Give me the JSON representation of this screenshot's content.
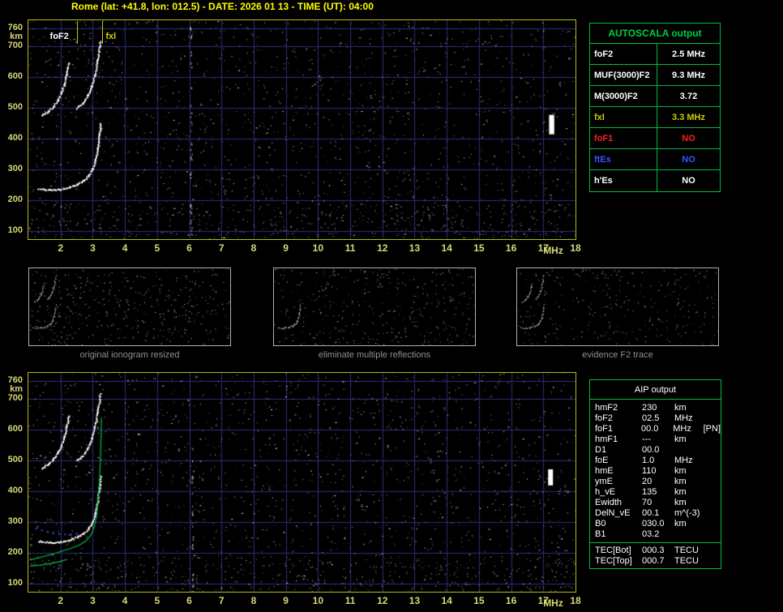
{
  "title": "Rome (lat: +41.8, lon: 012.5) - DATE: 2026 01 13 - TIME (UT): 04:00",
  "colors": {
    "title": "#ffff00",
    "axis_label": "#d8d878",
    "grid": "#2d2d7d",
    "plot_border": "#b8b818",
    "table_border": "#00bb44",
    "trace": "#ffffff",
    "green_overlay": "#00bb44",
    "blue_overlay": "#3355ff",
    "caption": "#909090"
  },
  "ionogram_axes": {
    "x_unit": "MHz",
    "y_unit": "km",
    "x_ticks": [
      2,
      3,
      4,
      5,
      6,
      7,
      8,
      9,
      10,
      11,
      12,
      13,
      14,
      15,
      16,
      17,
      18
    ],
    "y_ticks": [
      100,
      200,
      300,
      400,
      500,
      600,
      700,
      760
    ],
    "x_range": [
      1.0,
      18.0
    ],
    "y_range": [
      75,
      785
    ]
  },
  "traces": [
    {
      "name": "F-trace-first-order",
      "points": [
        [
          1.3,
          240
        ],
        [
          1.7,
          236
        ],
        [
          2.0,
          239
        ],
        [
          2.25,
          245
        ],
        [
          2.5,
          254
        ],
        [
          2.7,
          266
        ],
        [
          2.85,
          282
        ],
        [
          2.97,
          303
        ],
        [
          3.07,
          332
        ],
        [
          3.14,
          370
        ],
        [
          3.19,
          415
        ],
        [
          3.23,
          450
        ]
      ]
    },
    {
      "name": "second-order-O",
      "points": [
        [
          1.4,
          478
        ],
        [
          1.6,
          490
        ],
        [
          1.75,
          506
        ],
        [
          1.9,
          527
        ],
        [
          2.0,
          550
        ],
        [
          2.1,
          578
        ],
        [
          2.18,
          613
        ],
        [
          2.24,
          648
        ]
      ]
    },
    {
      "name": "second-order-X",
      "points": [
        [
          2.5,
          502
        ],
        [
          2.68,
          518
        ],
        [
          2.83,
          542
        ],
        [
          2.95,
          572
        ],
        [
          3.05,
          610
        ],
        [
          3.14,
          658
        ],
        [
          3.22,
          718
        ]
      ]
    }
  ],
  "top_ionogram": {
    "noise_seed": 7,
    "noise_count": 1600,
    "trace_ids": [
      0,
      1,
      2
    ],
    "band_noise": {
      "count": 320,
      "km_max": 190
    },
    "streaks": [
      {
        "x": 6.05,
        "km1": 75,
        "km2": 785,
        "count": 42
      }
    ],
    "blobs": [
      {
        "x1": 17.18,
        "x2": 17.34,
        "y1": 415,
        "y2": 478
      }
    ],
    "annotations": [
      {
        "label": "foF2",
        "freq_mhz": 2.5,
        "color": "#ffffff"
      },
      {
        "label": "fxl",
        "freq_mhz": 3.3,
        "color": "#cccc00"
      }
    ]
  },
  "bottom_ionogram": {
    "noise_seed": 13,
    "noise_count": 1600,
    "trace_ids": [
      0,
      1,
      2
    ],
    "band_noise": {
      "count": 300,
      "km_max": 190
    },
    "streaks": [
      {
        "x": 6.1,
        "km1": 75,
        "km2": 540,
        "count": 36
      }
    ],
    "blobs": [
      {
        "x1": 17.15,
        "x2": 17.3,
        "y1": 420,
        "y2": 472
      }
    ],
    "overlays": [
      {
        "name": "model-F2-trace",
        "color": "#00bb44",
        "style": "line",
        "points": [
          [
            1.05,
            178
          ],
          [
            1.5,
            190
          ],
          [
            1.9,
            202
          ],
          [
            2.3,
            215
          ],
          [
            2.6,
            227
          ],
          [
            2.8,
            241
          ],
          [
            2.95,
            260
          ],
          [
            3.05,
            286
          ],
          [
            3.12,
            322
          ],
          [
            3.18,
            382
          ],
          [
            3.22,
            455
          ],
          [
            3.25,
            545
          ],
          [
            3.27,
            640
          ]
        ]
      },
      {
        "name": "model-E-profile",
        "color": "#00bb44",
        "style": "line",
        "points": [
          [
            1.05,
            158
          ],
          [
            1.35,
            161
          ],
          [
            1.65,
            166
          ],
          [
            1.95,
            172
          ],
          [
            2.2,
            180
          ]
        ]
      },
      {
        "name": "hmF2-markers",
        "color": "#3355ff",
        "style": "dots",
        "points": [
          [
            1.25,
            280
          ],
          [
            1.42,
            274
          ],
          [
            1.6,
            269
          ],
          [
            1.78,
            265
          ],
          [
            1.96,
            262
          ],
          [
            2.14,
            261
          ],
          [
            2.32,
            261
          ],
          [
            2.5,
            263
          ]
        ]
      }
    ]
  },
  "autoscala_table": {
    "header": "AUTOSCALA output",
    "rows": [
      {
        "param": "foF2",
        "value": "2.5 MHz",
        "color": "#ffffff"
      },
      {
        "param": "MUF(3000)F2",
        "value": "9.3 MHz",
        "color": "#ffffff"
      },
      {
        "param": "M(3000)F2",
        "value": "3.72",
        "color": "#ffffff"
      },
      {
        "param": "fxl",
        "value": "3.3 MHz",
        "color": "#cccc00"
      },
      {
        "param": "foF1",
        "value": "NO",
        "color": "#ff2020"
      },
      {
        "param": "ftEs",
        "value": "NO",
        "color": "#3355ff"
      },
      {
        "param": "h'Es",
        "value": "NO",
        "color": "#ffffff"
      }
    ]
  },
  "thumbnails": [
    {
      "caption": "original ionogram resized",
      "noise_seed": 21,
      "noise_count": 430,
      "trace_ids": [
        0,
        1,
        2
      ]
    },
    {
      "caption": "eliminate multiple reflections",
      "noise_seed": 33,
      "noise_count": 390,
      "trace_ids": [
        0
      ]
    },
    {
      "caption": "evidence F2 trace",
      "noise_seed": 44,
      "noise_count": 300,
      "trace_ids": [
        0,
        1,
        2
      ]
    }
  ],
  "aip_table": {
    "header": "AIP output",
    "rows": [
      {
        "param": "hmF2",
        "value": "230",
        "unit": "km",
        "extra": ""
      },
      {
        "param": "foF2",
        "value": "02.5",
        "unit": "MHz",
        "extra": ""
      },
      {
        "param": "foF1",
        "value": "00.0",
        "unit": "MHz",
        "extra": "[PN]"
      },
      {
        "param": "hmF1",
        "value": "---",
        "unit": "km",
        "extra": ""
      },
      {
        "param": "D1",
        "value": "00.0",
        "unit": "",
        "extra": ""
      },
      {
        "param": "foE",
        "value": "1.0",
        "unit": "MHz",
        "extra": ""
      },
      {
        "param": "hmE",
        "value": "110",
        "unit": "km",
        "extra": ""
      },
      {
        "param": "ymE",
        "value": "20",
        "unit": "km",
        "extra": ""
      },
      {
        "param": "h_vE",
        "value": "135",
        "unit": "km",
        "extra": ""
      },
      {
        "param": "Ewidth",
        "value": "70",
        "unit": "km",
        "extra": ""
      },
      {
        "param": "DelN_vE",
        "value": "00.1",
        "unit": "m^(-3)",
        "extra": ""
      },
      {
        "param": "B0",
        "value": "030.0",
        "unit": "km",
        "extra": ""
      },
      {
        "param": "B1",
        "value": "03.2",
        "unit": "",
        "extra": ""
      }
    ],
    "tec_rows": [
      {
        "param": "TEC[Bot]",
        "value": "000.3",
        "unit": "TECU"
      },
      {
        "param": "TEC[Top]",
        "value": "000.7",
        "unit": "TECU"
      }
    ]
  }
}
